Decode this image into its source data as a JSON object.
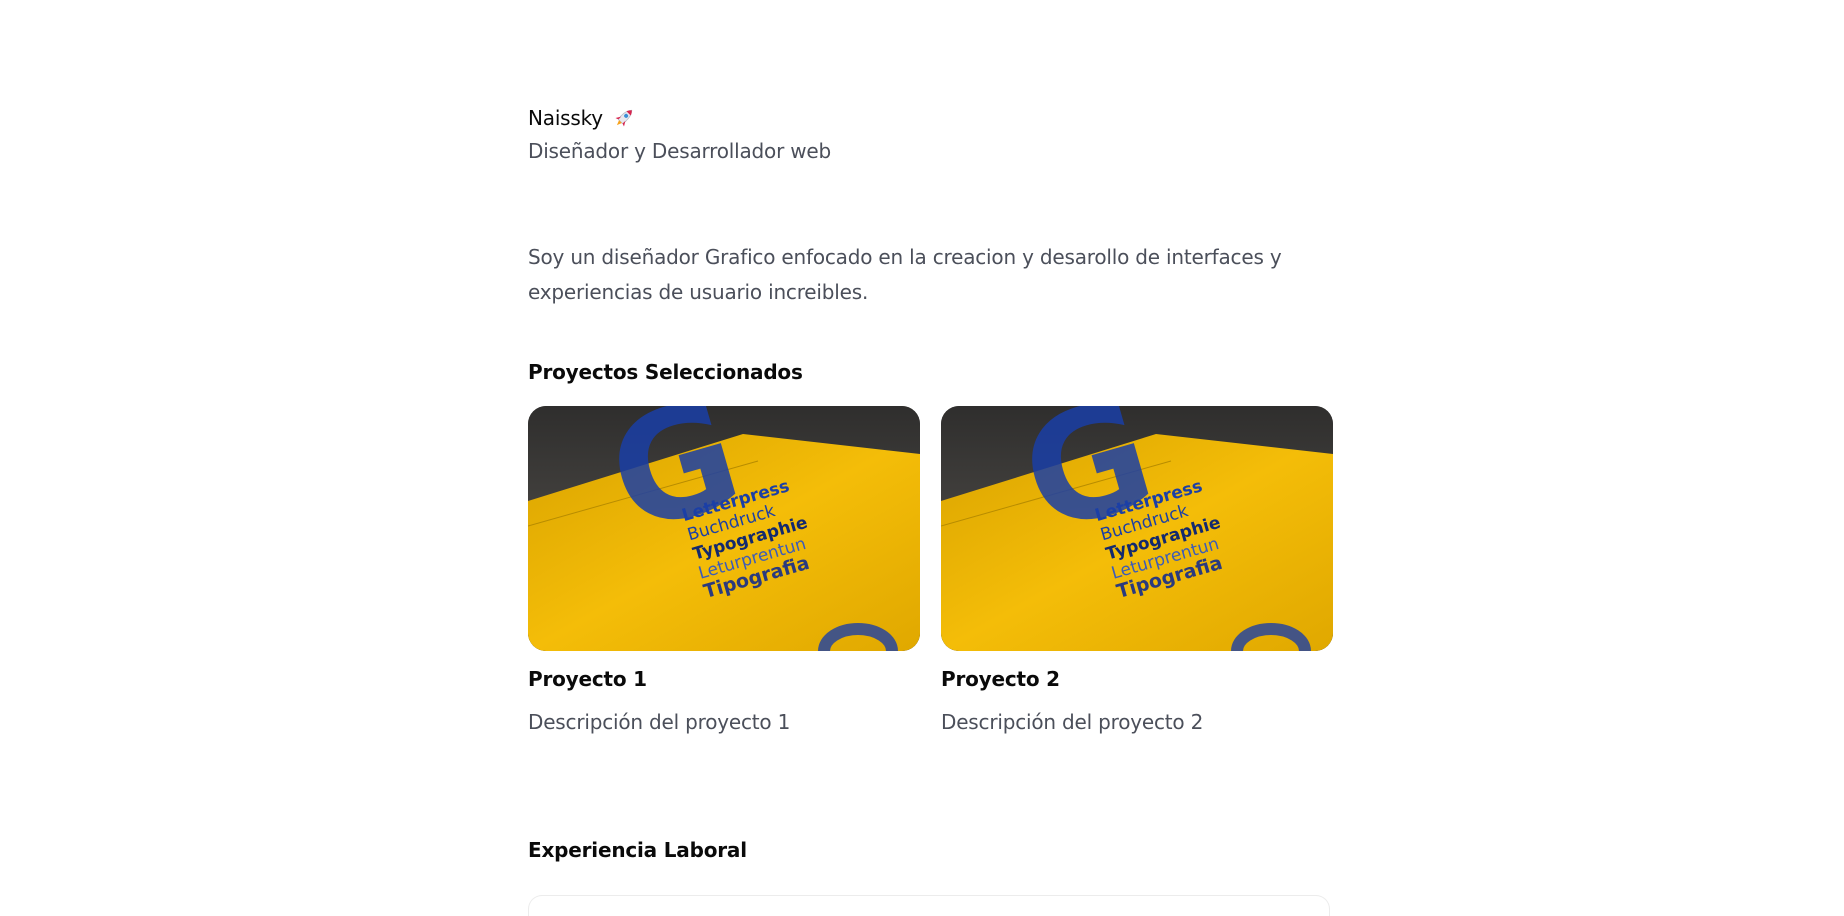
{
  "profile": {
    "name": "Naissky",
    "role": "Diseñador y Desarrollador web",
    "bio": "Soy un diseñador Grafico enfocado en la creacion y desarollo de interfaces y experiencias de usuario increibles."
  },
  "projects_section": {
    "title": "Proyectos Seleccionados",
    "items": [
      {
        "title": "Proyecto 1",
        "description": "Descripción del proyecto 1",
        "image_words": [
          "Letterpress",
          "Buchdruck",
          "Typographie",
          "Leturprentun",
          "Tipografia"
        ]
      },
      {
        "title": "Proyecto 2",
        "description": "Descripción del proyecto 2",
        "image_words": [
          "Letterpress",
          "Buchdruck",
          "Typographie",
          "Leturprentun",
          "Tipografia"
        ]
      }
    ]
  },
  "experience_section": {
    "title": "Experiencia Laboral"
  },
  "colors": {
    "text_primary": "#0a0a0a",
    "text_secondary": "#4b4f5a",
    "poster_yellow": "#f2b705",
    "poster_blue": "#1b3fa6",
    "background": "#ffffff"
  },
  "icons": {
    "name_emoji": "rocket-icon"
  }
}
